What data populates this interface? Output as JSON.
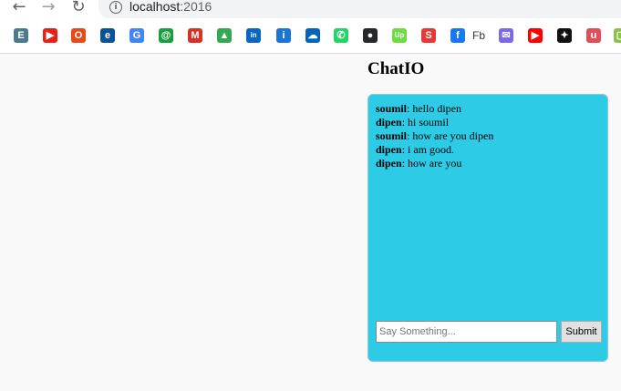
{
  "browser": {
    "url_host": "localhost",
    "url_port": ":2016",
    "bookmarks": [
      {
        "name": "e-bookmark",
        "glyph": "E",
        "color": "#4a7a8c"
      },
      {
        "name": "red-play-bookmark",
        "glyph": "▶",
        "color": "#e62117"
      },
      {
        "name": "office-bookmark",
        "glyph": "O",
        "color": "#e64a19"
      },
      {
        "name": "blue-circle-bookmark",
        "glyph": "e",
        "color": "#0b5394"
      },
      {
        "name": "google-bookmark",
        "glyph": "G",
        "color": "#4285f4"
      },
      {
        "name": "green-swirl-bookmark",
        "glyph": "@",
        "color": "#1b9e3e"
      },
      {
        "name": "gmail-bookmark",
        "glyph": "M",
        "color": "#d93025"
      },
      {
        "name": "drive-bookmark",
        "glyph": "▲",
        "color": "#34a853"
      },
      {
        "name": "linkedin-bookmark",
        "glyph": "in",
        "color": "#0a66c2"
      },
      {
        "name": "info-bookmark",
        "glyph": "i",
        "color": "#1976d2"
      },
      {
        "name": "onedrive-bookmark",
        "glyph": "☁",
        "color": "#0364b8"
      },
      {
        "name": "whatsapp-bookmark",
        "glyph": "✆",
        "color": "#25d366"
      },
      {
        "name": "github-bookmark",
        "glyph": "●",
        "color": "#24292e"
      },
      {
        "name": "upwork-bookmark",
        "glyph": "Up",
        "color": "#6fda44"
      },
      {
        "name": "red-s-bookmark",
        "glyph": "S",
        "color": "#e53935"
      },
      {
        "name": "facebook-bookmark",
        "glyph": "f",
        "color": "#1877f2"
      },
      {
        "name": "mail-bookmark",
        "glyph": "✉",
        "color": "#7b68ee"
      },
      {
        "name": "youtube-bookmark",
        "glyph": "▶",
        "color": "#ff0000"
      },
      {
        "name": "star-bookmark",
        "glyph": "✦",
        "color": "#111111"
      },
      {
        "name": "udemy-bookmark",
        "glyph": "u",
        "color": "#e04e5a"
      },
      {
        "name": "green-bookmark",
        "glyph": "▢",
        "color": "#8bc34a"
      }
    ],
    "fb_label": "Fb"
  },
  "page": {
    "title": "ChatIO",
    "messages": [
      {
        "user": "soumil",
        "text": ": hello dipen"
      },
      {
        "user": "dipen",
        "text": ": hi soumil"
      },
      {
        "user": "soumil",
        "text": ": how are you dipen"
      },
      {
        "user": "dipen",
        "text": ": i am good."
      },
      {
        "user": "dipen",
        "text": ": how are you"
      }
    ],
    "input_placeholder": "Say Something...",
    "input_value": "",
    "submit_label": "Submit",
    "panel_color": "#2ecbe6"
  }
}
